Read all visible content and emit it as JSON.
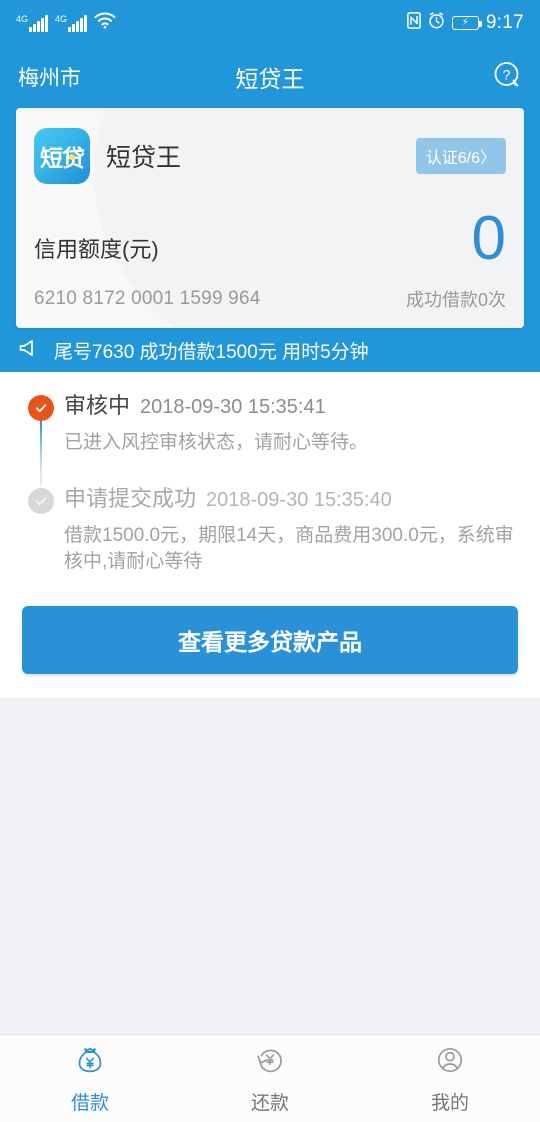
{
  "status_bar": {
    "network_label": "4G",
    "network_label_2": "4G",
    "wifi_icon": "wifi-icon",
    "nfc_icon": "nfc-icon",
    "alarm_icon": "alarm-icon",
    "battery_icon": "battery-charging-icon",
    "time": "9:17"
  },
  "header": {
    "city": "梅州市",
    "title": "短贷王",
    "help_icon": "help-bubble-icon"
  },
  "card": {
    "app_icon_text": "短贷",
    "name": "短贷王",
    "verify_badge": "认证6/6〉",
    "credit_label": "信用额度(元)",
    "credit_amount": "0",
    "card_number": "6210 8172 0001 1599 964",
    "loan_count": "成功借款0次"
  },
  "notice": {
    "icon": "speaker-icon",
    "text": "尾号7630 成功借款1500元 用时5分钟"
  },
  "timeline": [
    {
      "status": "审核中",
      "time": "2018-09-30 15:35:41",
      "desc": "已进入风控审核状态，请耐心等待。",
      "state": "active"
    },
    {
      "status": "申请提交成功",
      "time": "2018-09-30 15:35:40",
      "desc": "借款1500.0元，期限14天，商品费用300.0元，系统审核中,请耐心等待",
      "state": "done"
    }
  ],
  "cta": {
    "label": "查看更多贷款产品"
  },
  "tabs": [
    {
      "label": "借款",
      "icon": "money-bag-icon",
      "active": true
    },
    {
      "label": "还款",
      "icon": "repay-refresh-icon",
      "active": false
    },
    {
      "label": "我的",
      "icon": "person-circle-icon",
      "active": false
    }
  ],
  "colors": {
    "brand_blue": "#2196d9",
    "accent_blue": "#2f8fd4",
    "active_orange": "#e8551a",
    "badge_blue": "#92c6e8",
    "page_gray": "#f0f2f5"
  }
}
